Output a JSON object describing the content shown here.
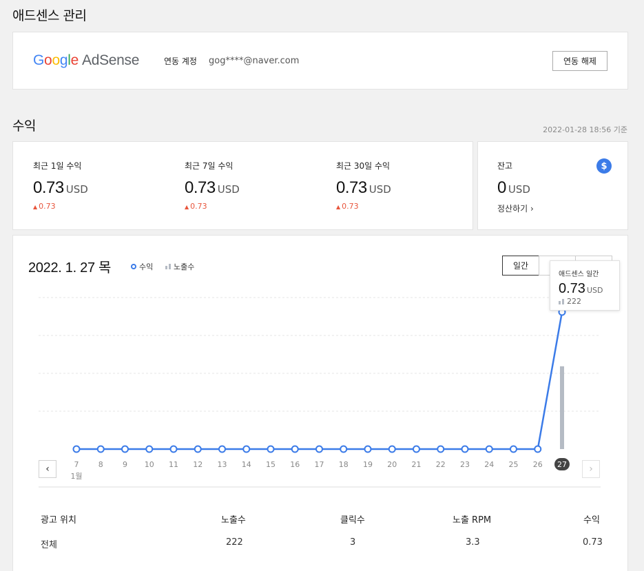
{
  "adsense_section": {
    "title": "애드센스 관리",
    "logo": {
      "g1": "G",
      "o1": "o",
      "o2": "o",
      "g2": "g",
      "l": "l",
      "e": "e",
      "product": "AdSense"
    },
    "account_label": "연동 계정",
    "account_value": "gog****@naver.com",
    "unlink_button": "연동 해제"
  },
  "revenue_section": {
    "title": "수익",
    "updated_at": "2022-01-28 18:56 기준",
    "stats": [
      {
        "label": "최근 1일 수익",
        "value": "0.73",
        "unit": "USD",
        "change": "0.73"
      },
      {
        "label": "최근 7일 수익",
        "value": "0.73",
        "unit": "USD",
        "change": "0.73"
      },
      {
        "label": "최근 30일 수익",
        "value": "0.73",
        "unit": "USD",
        "change": "0.73"
      }
    ],
    "balance": {
      "label": "잔고",
      "value": "0",
      "unit": "USD",
      "settle_link": "정산하기 ›",
      "icon": "dollar-icon"
    }
  },
  "chart_section": {
    "date_title": "2022. 1. 27 목",
    "legend": {
      "revenue": "수익",
      "impressions": "노출수"
    },
    "period_button": "일간",
    "month_label": "1월",
    "tooltip": {
      "title": "애드센스 일간",
      "value": "0.73",
      "unit": "USD",
      "impressions": "222"
    }
  },
  "chart_data": {
    "type": "line",
    "x": [
      "7",
      "8",
      "9",
      "10",
      "11",
      "12",
      "13",
      "14",
      "15",
      "16",
      "17",
      "18",
      "19",
      "20",
      "21",
      "22",
      "23",
      "24",
      "25",
      "26",
      "27"
    ],
    "series": [
      {
        "name": "수익",
        "values": [
          0,
          0,
          0,
          0,
          0,
          0,
          0,
          0,
          0,
          0,
          0,
          0,
          0,
          0,
          0,
          0,
          0,
          0,
          0,
          0,
          0.73
        ]
      },
      {
        "name": "노출수",
        "values": [
          0,
          0,
          0,
          0,
          0,
          0,
          0,
          0,
          0,
          0,
          0,
          0,
          0,
          0,
          0,
          0,
          0,
          0,
          0,
          0,
          222
        ]
      }
    ],
    "selected_x": "27",
    "colors": {
      "revenue": "#3b7be8",
      "impressions": "#b5bbc4"
    }
  },
  "table": {
    "headers": [
      "광고 위치",
      "노출수",
      "클릭수",
      "노출 RPM",
      "수익"
    ],
    "rows": [
      [
        "전체",
        "222",
        "3",
        "3.3",
        "0.73"
      ]
    ]
  }
}
